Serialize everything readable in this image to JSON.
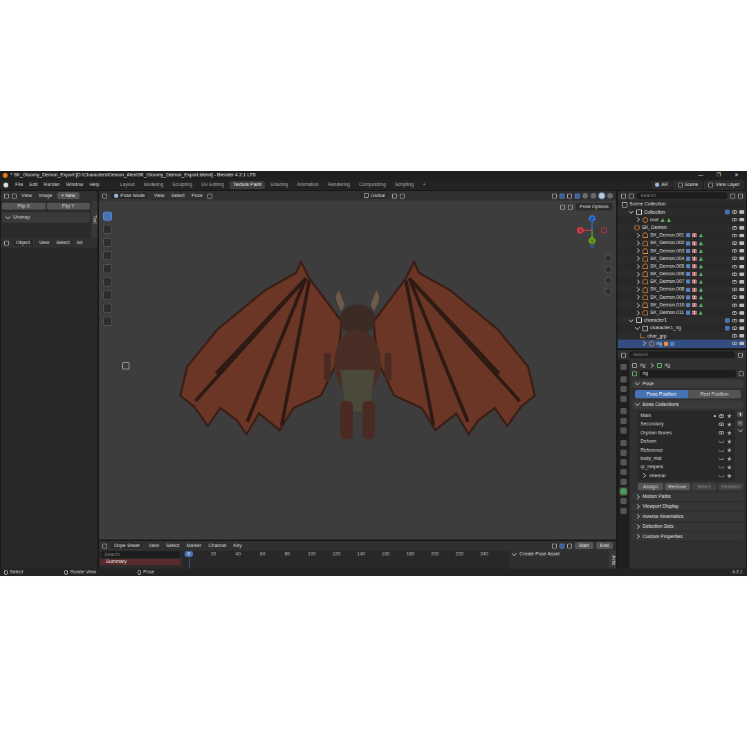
{
  "window": {
    "title": "* SK_Gloomy_Demon_Export [D:\\Characters\\Demon_Alex\\SK_Gloomy_Demon_Export.blend] - Blender 4.2.1 LTS",
    "controls": [
      "—",
      "❐",
      "✕"
    ]
  },
  "menu": [
    "File",
    "Edit",
    "Render",
    "Window",
    "Help"
  ],
  "workspaces": [
    {
      "label": "Layout",
      "selected": false
    },
    {
      "label": "Modeling",
      "selected": false
    },
    {
      "label": "Sculpting",
      "selected": false
    },
    {
      "label": "UV Editing",
      "selected": false
    },
    {
      "label": "Texture Paint",
      "selected": true
    },
    {
      "label": "Shading",
      "selected": false
    },
    {
      "label": "Animation",
      "selected": false
    },
    {
      "label": "Rendering",
      "selected": false
    },
    {
      "label": "Compositing",
      "selected": false
    },
    {
      "label": "Scripting",
      "selected": false
    }
  ],
  "add_workspace": "+",
  "topbar_right": {
    "xr": "AR",
    "scene": "Scene",
    "view_layer": "View Layer"
  },
  "image_editor": {
    "menu": [
      "View",
      "Image"
    ],
    "new_button": "+ New",
    "flip": [
      "Flip X",
      "Flip Y"
    ],
    "panel": "Unwrap",
    "sidebar_tab": "Tool",
    "lower_header": {
      "mode": "Object",
      "menu": [
        "View",
        "Select",
        "Ad"
      ]
    }
  },
  "viewport": {
    "mode": "Pose Mode",
    "menu": [
      "View",
      "Select",
      "Pose"
    ],
    "orientation": "Global",
    "pose_options": "Pose Options",
    "gizmo": [
      {
        "label": "Z",
        "color": "#2f6fd6"
      },
      {
        "label": "X",
        "color": "#d9384a"
      },
      {
        "label": "Y",
        "color": "#6ba81e"
      }
    ]
  },
  "timeline": {
    "editor": "Dope Sheet",
    "menu": [
      "View",
      "Select",
      "Marker",
      "Channel",
      "Key"
    ],
    "start": "Start",
    "end": "End",
    "search_placeholder": "Search",
    "current_frame": "0",
    "ticks": [
      "20",
      "40",
      "60",
      "80",
      "100",
      "120",
      "140",
      "160",
      "180",
      "200",
      "220",
      "240"
    ],
    "channels": [
      "Summary"
    ],
    "side_panel": "Create Pose Asset",
    "side_tab": "Actio"
  },
  "outliner": {
    "search_placeholder": "Search",
    "items": [
      {
        "label": "Scene Collection",
        "depth": 0,
        "kind": "scene",
        "selected": false
      },
      {
        "label": "Collection",
        "depth": 1,
        "kind": "collection",
        "selected": false
      },
      {
        "label": "root",
        "depth": 2,
        "kind": "armature",
        "selected": false
      },
      {
        "label": "SK_Demon",
        "depth": 2,
        "kind": "bone",
        "selected": false
      },
      {
        "label": "SK_Demon.001",
        "depth": 2,
        "kind": "mesh",
        "selected": false
      },
      {
        "label": "SK_Demon.002",
        "depth": 2,
        "kind": "mesh",
        "selected": false
      },
      {
        "label": "SK_Demon.003",
        "depth": 2,
        "kind": "mesh",
        "selected": false
      },
      {
        "label": "SK_Demon.004",
        "depth": 2,
        "kind": "mesh",
        "selected": false
      },
      {
        "label": "SK_Demon.005",
        "depth": 2,
        "kind": "mesh",
        "selected": false
      },
      {
        "label": "SK_Demon.006",
        "depth": 2,
        "kind": "mesh",
        "selected": false
      },
      {
        "label": "SK_Demon.007",
        "depth": 2,
        "kind": "mesh",
        "selected": false
      },
      {
        "label": "SK_Demon.008",
        "depth": 2,
        "kind": "mesh",
        "selected": false
      },
      {
        "label": "SK_Demon.009",
        "depth": 2,
        "kind": "mesh",
        "selected": false
      },
      {
        "label": "SK_Demon.010",
        "depth": 2,
        "kind": "mesh",
        "selected": false
      },
      {
        "label": "SK_Demon.011",
        "depth": 2,
        "kind": "mesh",
        "selected": false
      },
      {
        "label": "character1",
        "depth": 1,
        "kind": "collection",
        "selected": false
      },
      {
        "label": "character1_rig",
        "depth": 2,
        "kind": "collection",
        "selected": false
      },
      {
        "label": "char_grp",
        "depth": 3,
        "kind": "empty",
        "selected": false
      },
      {
        "label": "rig",
        "depth": 3,
        "kind": "armature",
        "selected": true
      }
    ]
  },
  "properties": {
    "search_placeholder": "Search",
    "breadcrumb": [
      "rig",
      "rig"
    ],
    "name_field": "rig",
    "pose_panel": "Pose",
    "pose_buttons": [
      {
        "label": "Pose Position",
        "selected": true
      },
      {
        "label": "Rest Position",
        "selected": false
      }
    ],
    "bone_panel": "Bone Collections",
    "bone_collections": [
      {
        "label": "Main",
        "active": true,
        "visible": true,
        "has_children": false
      },
      {
        "label": "Secondary",
        "active": false,
        "visible": true,
        "has_children": false
      },
      {
        "label": "Orphan Bones",
        "active": false,
        "visible": true,
        "has_children": false
      },
      {
        "label": "Deform",
        "active": false,
        "visible": false,
        "has_children": false
      },
      {
        "label": "Reference",
        "active": false,
        "visible": false,
        "has_children": false
      },
      {
        "label": "body_mid",
        "active": false,
        "visible": false,
        "has_children": false
      },
      {
        "label": "qr_helpers",
        "active": false,
        "visible": false,
        "has_children": false
      },
      {
        "label": "internal",
        "active": false,
        "visible": false,
        "has_children": true
      }
    ],
    "collection_buttons": [
      {
        "label": "Assign",
        "disabled": false
      },
      {
        "label": "Remove",
        "disabled": false
      },
      {
        "label": "Select",
        "disabled": true
      },
      {
        "label": "Deselect",
        "disabled": true
      }
    ],
    "subpanels": [
      "Motion Paths",
      "Viewport Display",
      "Inverse Kinematics",
      "Selection Sets",
      "Custom Properties"
    ]
  },
  "status_bar": {
    "items": [
      "Select",
      "Rotate View",
      "Pose"
    ],
    "version": "4.2.1"
  }
}
